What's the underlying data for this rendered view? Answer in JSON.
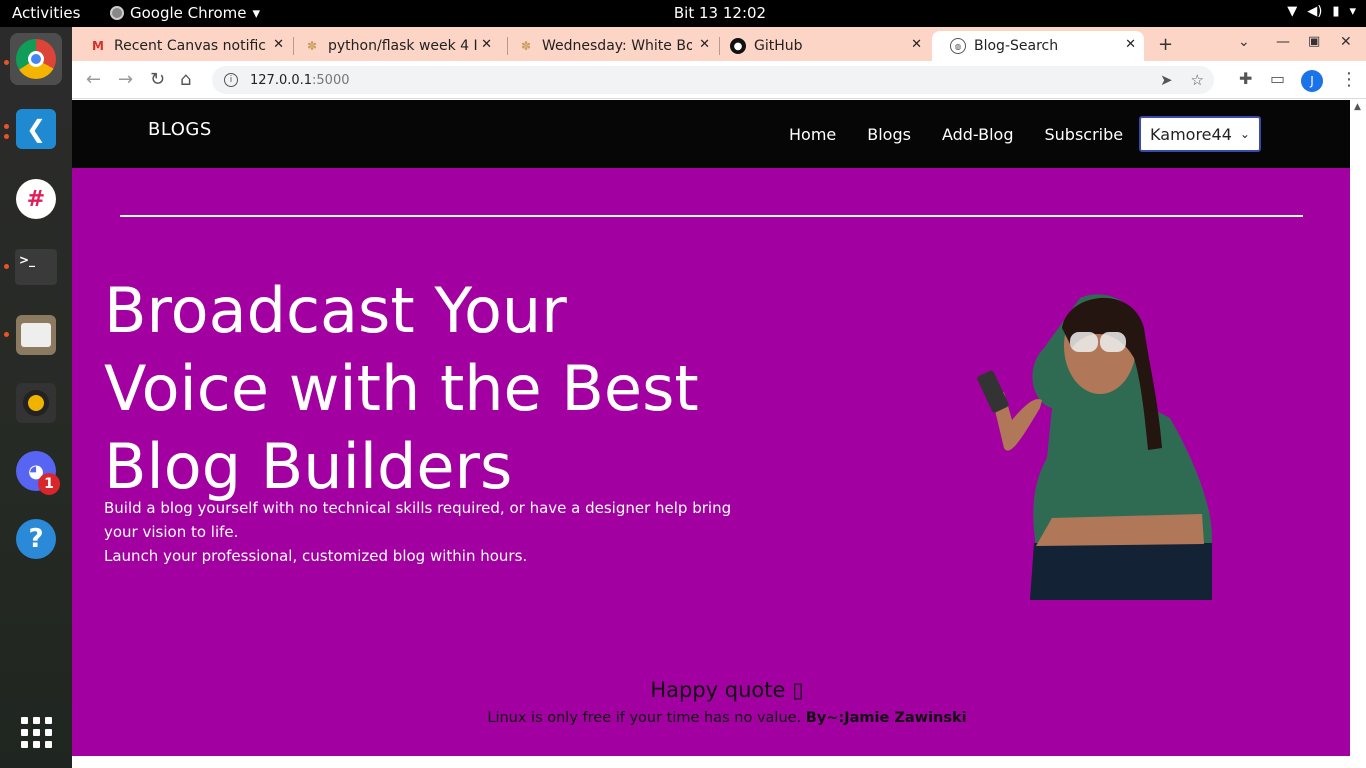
{
  "system": {
    "activities": "Activities",
    "app_name": "Google Chrome",
    "clock": "Bit 13  12:02"
  },
  "browser": {
    "tabs": [
      {
        "title": "Recent Canvas notific",
        "icon": "gmail-icon"
      },
      {
        "title": "python/flask week 4 I",
        "icon": "palm-tree-icon"
      },
      {
        "title": "Wednesday: White Bo",
        "icon": "palm-tree-icon"
      },
      {
        "title": "GitHub",
        "icon": "github-icon"
      },
      {
        "title": "Blog-Search",
        "icon": "globe-icon"
      }
    ],
    "url_host": "127.0.0.1",
    "url_port": ":5000",
    "profile_initial": "J"
  },
  "site": {
    "brand": "BLOGS",
    "nav": [
      "Home",
      "Blogs",
      "Add-Blog",
      "Subscribe"
    ],
    "user": "Kamore44",
    "hero": {
      "heading": "Broadcast Your Voice with the Best Blog Builders",
      "sub_line1": "Build a blog yourself with no technical skills required, or have a designer help bring your vision to life.",
      "sub_line2": "Launch your professional, customized blog within hours."
    },
    "quote": {
      "title": "Happy quote ▯",
      "text": "Linux is only free if your time has no value.",
      "author": "By~:Jamie Zawinski"
    }
  },
  "dock": {
    "notification_count": "1"
  },
  "colors": {
    "hero_bg": "#a200a0",
    "navbar_bg": "#060606",
    "tabstrip_bg": "#fdd5c6"
  }
}
